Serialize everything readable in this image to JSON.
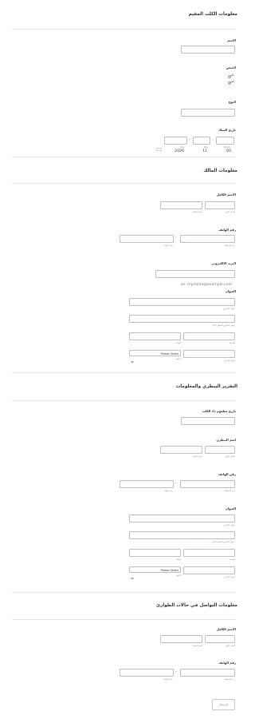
{
  "sections": {
    "dog_info": {
      "title": "معلومات الكلب المقيم",
      "name_label": "الاسم",
      "gender_label": "الجنس",
      "gender_male": "ذكر",
      "gender_female": "أنثى",
      "breed_label": "النوع",
      "dob_label": "تاريخ الميلاد",
      "dob_month": "05",
      "dob_day": "11",
      "dob_year": "2026",
      "dob_month_sub": "Month",
      "dob_day_sub": "Day",
      "dob_year_sub": "Year"
    },
    "owner_info": {
      "title": "معلومات المالك",
      "fullname_label": "الاسم الكامل",
      "first_name_sub": "الاسم الأول",
      "last_name_sub": "اسم العائلة",
      "phone_label": "رقم الهاتف",
      "area_code_sub": "رمز المنطقة",
      "phone_number_sub": "رقم الهاتف",
      "email_label": "البريد الالكتروني",
      "email_placeholder": "ex: myname@example.com",
      "address_label": "العنوان",
      "street_sub": "عنوان الشارع",
      "street2_sub": "عنوان الشارع السطر الثاني",
      "city_sub": "المدينة",
      "state_sub": "الولاية",
      "zip_sub": "الرمز البريدي",
      "country_sub": "الدولة",
      "country_select": "Please Select"
    },
    "vet_info": {
      "title": "التقرير البيطري والمعلومات",
      "rabies_label": "تاريخ مطعوم داء الكلب",
      "vet_name_label": "اسم البيطري",
      "first_name_sub": "الاسم الأول",
      "last_name_sub": "اسم العائلة",
      "phone_label": "رقن الهاتف",
      "area_code_sub": "رمز المنطقة",
      "phone_number_sub": "رقم الهاتف",
      "address_label": "العنوان",
      "street_sub": "عنوان الشارع",
      "street2_sub": "عنوان الشارع السطر الثاني",
      "city_sub": "المدينة",
      "state_sub": "الولاية",
      "zip_sub": "الرمز البريدي",
      "country_sub": "الدولة",
      "country_select": "Please Select"
    },
    "emergency": {
      "title": "معلومات التواصل في حالات الطوارئ",
      "fullname_label": "الاسم الكامل",
      "first_name_sub": "الاسم الأول",
      "last_name_sub": "اسم العائلة",
      "phone_label": "رقم الهاتف",
      "area_code_sub": "رمز المنطقة",
      "phone_number_sub": "رقم الهاتف"
    }
  },
  "submit_label": "الإرسال",
  "icons": {
    "calendar": "calendar-icon",
    "dropdown": "chevron-down-icon"
  },
  "colors": {
    "border": "#b8bdc9",
    "text": "#2c3345",
    "sub": "#8d8fa8",
    "placeholder": "#6f76a7"
  }
}
